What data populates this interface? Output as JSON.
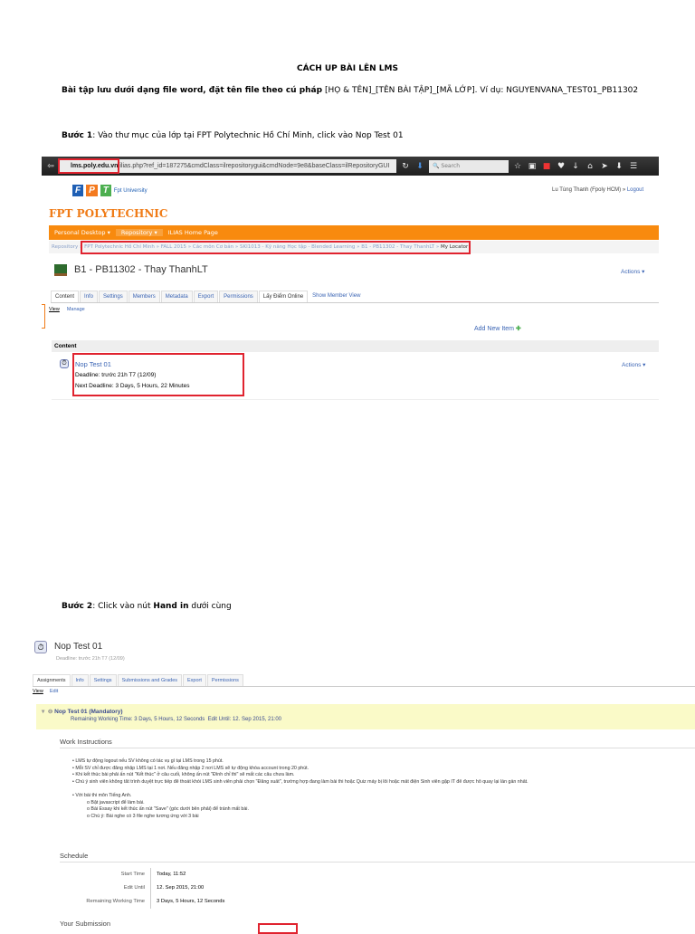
{
  "doc": {
    "title": "CÁCH UP BÀI LÊN LMS",
    "intro_bold": "Bài tập lưu dưới dạng file word, đặt tên file theo cú pháp",
    "intro_rest": " [HỌ & TÊN]_[TÊN BÀI TẬP]_[MÃ LỚP]. Ví dụ: NGUYENVANA_TEST01_PB11302",
    "step1_label": "Bước 1",
    "step1_text": ": Vào thư mục của lớp tại FPT Polytechnic Hồ Chí Minh, click vào Nop Test 01",
    "step2_label": "Bước 2",
    "step2_text": ": Click vào nút ",
    "step2_bold": "Hand in",
    "step2_end": " dưới cùng"
  },
  "shot1": {
    "url_host": "lms.poly.edu.vn",
    "url_rest": "/ilias.php?ref_id=187275&cmdClass=ilrepositorygui&cmdNode=9e8&baseClass=ilRepositoryGUI",
    "search_placeholder": "Search",
    "logo_text": "FPT",
    "logo_sub": "Fpt University",
    "brand": "FPT POLYTECHNIC",
    "user": "Lu Tùng Thanh (Fpoly HCM) »",
    "logout": "Logout",
    "nav": [
      "Personal Desktop ▾",
      "Repository ▾",
      "ILIAS Home Page"
    ],
    "breadcrumb_root": "Repository »",
    "breadcrumb": "FPT Polytechnic Hồ Chí Minh » FALL 2015 » Các môn Cơ bản » SKI1013 - Kỹ năng Học tập - Blended Learning » B1 - PB11302 - Thay ThanhLT »",
    "breadcrumb_current": "My Locator",
    "page_title": "B1 - PB11302 - Thay ThanhLT",
    "actions": "Actions ▾",
    "tabs": [
      "Content",
      "Info",
      "Settings",
      "Members",
      "Metadata",
      "Export",
      "Permissions",
      "Lấy Điểm Online",
      "Show Member View"
    ],
    "subtabs": [
      "View",
      "Manage"
    ],
    "add_new_item": "Add New Item",
    "content_header": "Content",
    "item_title": "Nop Test 01",
    "item_deadline": "Deadline: trước 21h T7 (12/09)",
    "item_next_deadline": "Next Deadline: 3 Days, 5 Hours, 22 Minutes",
    "item_actions": "Actions ▾"
  },
  "shot2": {
    "title": "Nop Test 01",
    "deadline": "Deadline: trước 21h T7 (12/09)",
    "tabs": [
      "Assignments",
      "Info",
      "Settings",
      "Submissions and Grades",
      "Export",
      "Permissions"
    ],
    "subtabs": [
      "View",
      "Edit"
    ],
    "assignment_title": "Nop Test 01 (Mandatory)",
    "assignment_sub": "Remaining Working Time: 3 Days, 5 Hours, 12 Seconds  Edit Until: 12. Sep 2015, 21:00",
    "work_instructions": "Work Instructions",
    "bullets": [
      "LMS tự động logout nếu SV không có tác vụ gì tại LMS trong 15 phút.",
      "Mỗi SV chỉ được đăng nhập LMS tại 1 nơi. Nếu đăng nhập 2 nơi LMS sẽ tự động khóa account trong 20 phút.",
      "Khi kết thúc bài phải ấn nút \"Kết thúc\" ở câu cuối, không ấn nút \"Đình chỉ thi\" sẽ mất các câu chưa làm.",
      "Chú ý sinh viên không tắt trình duyệt trực tiếp để thoát khỏi LMS sinh viên phải chọn \"Đăng xuất\", trường hợp đang làm bài thi hoặc Quiz máy bị lỗi hoặc mất điện Sinh viên gặp IT để được hỗ quay lại lần gần nhất.",
      "Với bài thi môn Tiếng Anh."
    ],
    "sub_bullets": [
      "Bật javascript để làm bài.",
      "Bài Essay khi kết thúc ấn nút \"Save\" (góc dưới bên phải) để tránh mất bài.",
      "Chú ý: Bài nghe có 3 file nghe tương ứng với 3 bài"
    ],
    "schedule": "Schedule",
    "schedule_rows": [
      {
        "label": "Start Time",
        "value": "Today, 11:52"
      },
      {
        "label": "Edit Until",
        "value": "12. Sep 2015, 21:00"
      },
      {
        "label": "Remaining Working Time",
        "value": "3 Days, 5 Hours, 12 Seconds"
      }
    ],
    "your_submission": "Your Submission"
  }
}
